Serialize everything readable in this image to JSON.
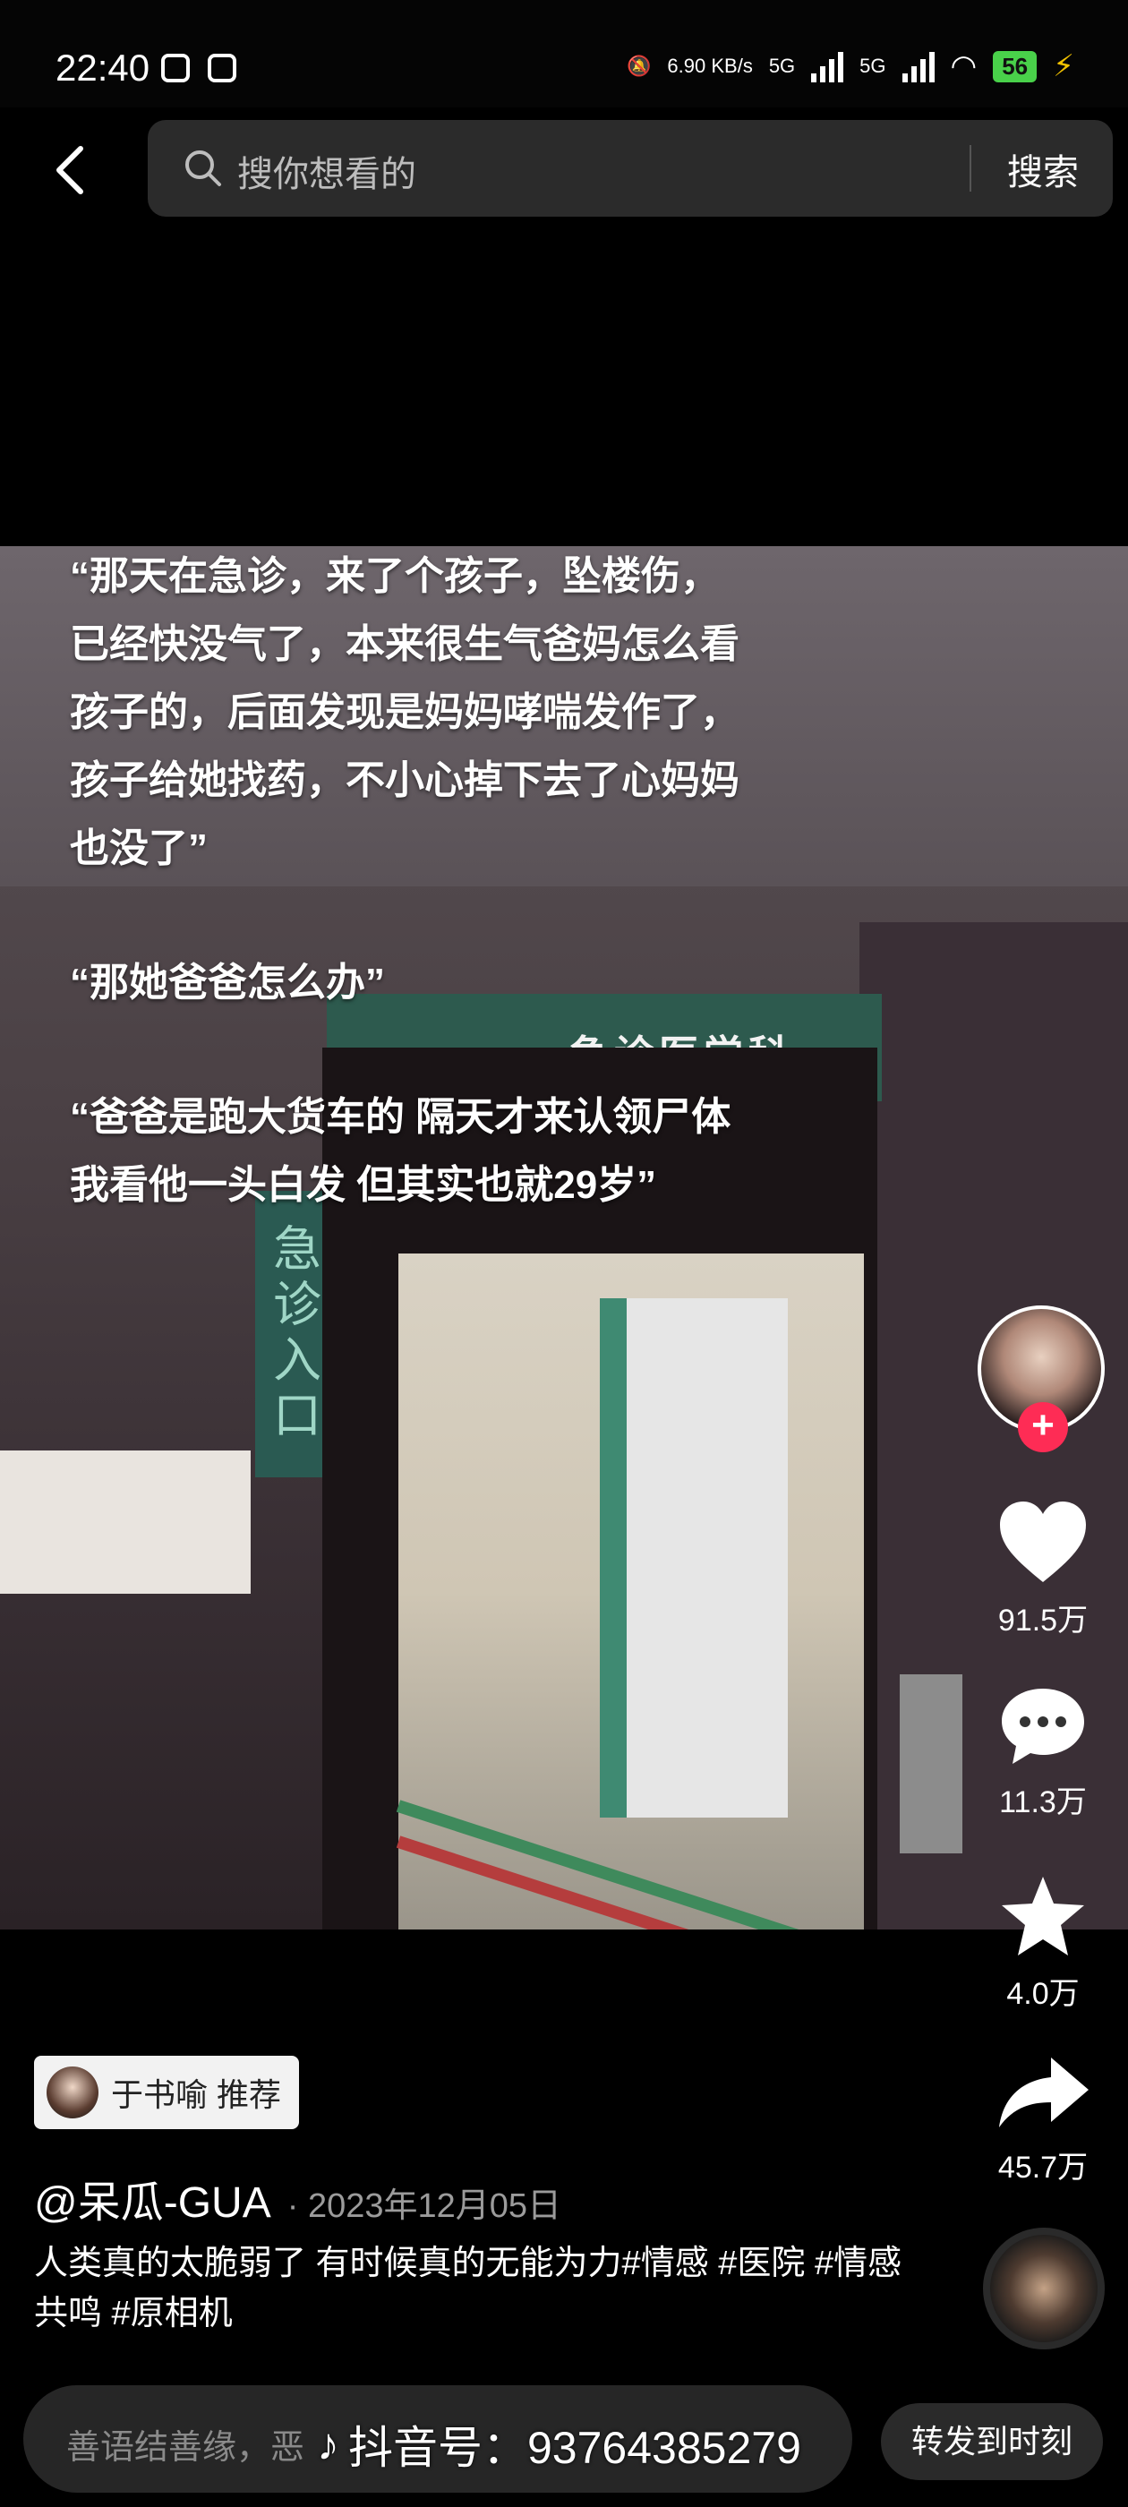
{
  "status_bar": {
    "time": "22:40",
    "net_speed": "6.90 KB/s",
    "network_1": "5G",
    "network_2": "5G",
    "battery": "56"
  },
  "search": {
    "placeholder": "搜你想看的",
    "button_label": "搜索"
  },
  "video": {
    "overlay_lines": [
      "“那天在急诊，来了个孩子，坠楼伤，已经快没气了，本来很生气爸妈怎么看孩子的，后面发现是妈妈哮喘发作了，孩子给她找药，不小心掉下去了心妈妈也没了”",
      "“那她爸爸怎么办”",
      "“爸爸是跑大货车的 隔天才来认领尸体 我看他一头白发 但其实也就29岁”"
    ],
    "sign_text": "急诊医学科",
    "vertical_sign": "急诊入口"
  },
  "actions": {
    "likes": "91.5万",
    "comments": "11.3万",
    "favorites": "4.0万",
    "shares": "45.7万"
  },
  "recommendation": {
    "text": "于书喻 推荐"
  },
  "post": {
    "author": "@呆瓜-GUA",
    "date": "· 2023年12月05日",
    "caption": "人类真的太脆弱了 有时候真的无能为力#情感 #医院 #情感共鸣 #原相机"
  },
  "bottom": {
    "comment_placeholder": "善语结善缘，恶",
    "watermark": "抖音号：93764385279",
    "repost_label": "转发到时刻"
  },
  "colors": {
    "accent": "#fe2c55",
    "battery": "#49d14a"
  }
}
